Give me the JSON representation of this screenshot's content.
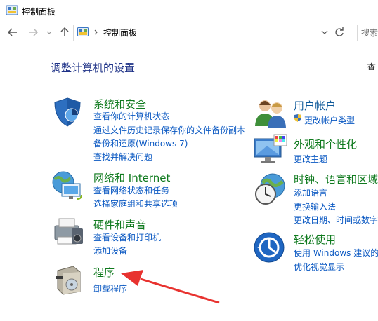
{
  "window": {
    "title": "控制面板"
  },
  "address": {
    "path": "控制面板",
    "search_placeholder": "搜索"
  },
  "main": {
    "heading": "调整计算机的设置",
    "view_by": "查"
  },
  "categories": [
    {
      "title": "系统和安全",
      "links": [
        "查看你的计算机状态",
        "通过文件历史记录保存你的文件备份副本",
        "备份和还原(Windows 7)",
        "查找并解决问题"
      ]
    },
    {
      "title": "网络和 Internet",
      "links": [
        "查看网络状态和任务",
        "选择家庭组和共享选项"
      ]
    },
    {
      "title": "硬件和声音",
      "links": [
        "查看设备和打印机",
        "添加设备"
      ]
    },
    {
      "title": "程序",
      "links": [
        "卸载程序"
      ]
    },
    {
      "title": "用户帐户",
      "links": [
        "更改帐户类型"
      ]
    },
    {
      "title": "外观和个性化",
      "links": [
        "更改主题"
      ]
    },
    {
      "title": "时钟、语言和区域",
      "links": [
        "添加语言",
        "更换输入法",
        "更改日期、时间或数字"
      ]
    },
    {
      "title": "轻松使用",
      "links": [
        "使用 Windows 建议的",
        "优化视觉显示"
      ]
    }
  ],
  "annotation": {
    "arrow_color": "#e8322f"
  }
}
